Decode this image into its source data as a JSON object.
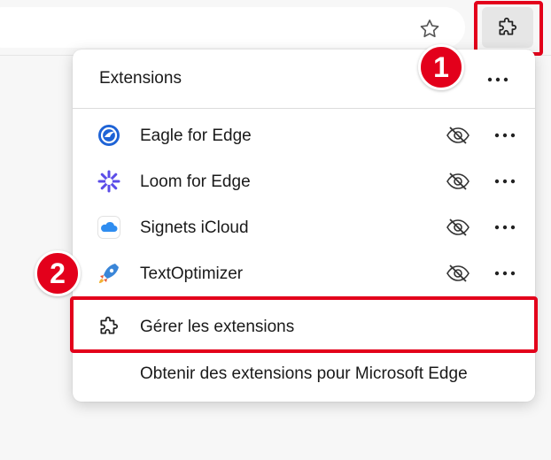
{
  "toolbar": {
    "favorite_icon": "star-outline-icon",
    "extensions_icon": "puzzle-icon"
  },
  "annotations": {
    "badge1": "1",
    "badge2": "2",
    "highlight_color": "#e3001b"
  },
  "menu": {
    "title": "Extensions",
    "items": [
      {
        "label": "Eagle for Edge",
        "icon": "eagle-logo-icon"
      },
      {
        "label": "Loom for Edge",
        "icon": "loom-logo-icon"
      },
      {
        "label": "Signets iCloud",
        "icon": "icloud-logo-icon"
      },
      {
        "label": "TextOptimizer",
        "icon": "textoptimizer-logo-icon"
      }
    ],
    "manage_label": "Gérer les extensions",
    "get_label": "Obtenir des extensions pour Microsoft Edge"
  }
}
